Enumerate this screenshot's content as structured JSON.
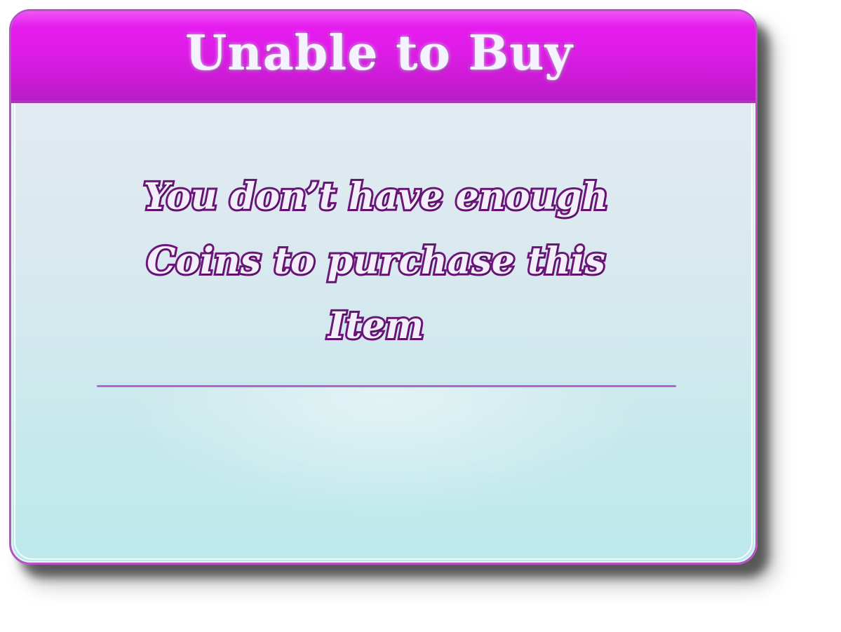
{
  "dialog": {
    "title": "Unable to Buy",
    "message_lines": [
      "You don’t have enough",
      "Coins to purchase this",
      "Item"
    ]
  },
  "colors": {
    "header": "#e01de9",
    "border": "#b552c4",
    "text_outline": "#6b1679",
    "divider": "#b663cf"
  }
}
